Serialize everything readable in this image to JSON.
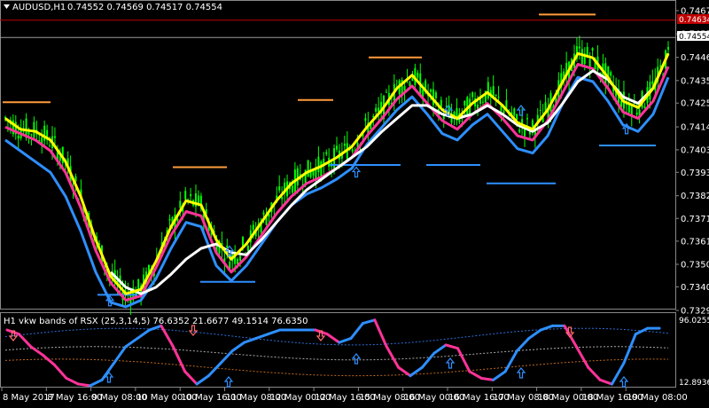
{
  "chart_header": {
    "symbol_label": "AUDUSD,H1",
    "ohlc": "0.74552 0.74569 0.74517 0.74554"
  },
  "indicator_header": {
    "label": "H1 vkw bands of RSX (25,3,14,5) 76.6352 21.6677 49.1514 76.6350"
  },
  "colors": {
    "background": "#000000",
    "candles": "#00ff00",
    "yellow_line": "#ffff00",
    "white_line": "#ffffff",
    "pink_line": "#ff3399",
    "blue_line": "#2e8fff",
    "resistance": "#ff9c3a",
    "support": "#2e8fff",
    "price_line": "#c00000",
    "bid_line": "#9a9a9a"
  },
  "chart_data": [
    {
      "type": "candlestick",
      "title": "AUDUSD,H1",
      "price_axis_ticks": [
        "0.74678",
        "0.74571",
        "0.74462",
        "0.74355",
        "0.74251",
        "0.74141",
        "0.74035",
        "0.73931",
        "0.73823",
        "0.73718",
        "0.73613",
        "0.73506",
        "0.73402",
        "0.73293"
      ],
      "ylim": [
        0.73293,
        0.74678
      ],
      "time_axis_ticks": [
        "8 May 2017",
        "8 May 16:00",
        "9 May 08:00",
        "10 May 00:00",
        "10 May 16:00",
        "11 May 08:00",
        "12 May 00:00",
        "12 May 16:00",
        "15 May 08:00",
        "16 May 00:00",
        "16 May 16:00",
        "17 May 08:00",
        "18 May 00:00",
        "18 May 16:00",
        "19 May 08:00"
      ],
      "price_labels": {
        "red": "0.74634",
        "current": "0.74554"
      },
      "series": [
        {
          "name": "yellow",
          "values": [
            0.7418,
            0.7413,
            0.7412,
            0.7408,
            0.7398,
            0.7382,
            0.7362,
            0.7345,
            0.7337,
            0.7339,
            0.7352,
            0.7368,
            0.738,
            0.7378,
            0.7362,
            0.7353,
            0.736,
            0.737,
            0.738,
            0.7388,
            0.7393,
            0.7396,
            0.74,
            0.7405,
            0.7414,
            0.7422,
            0.7432,
            0.7438,
            0.743,
            0.7422,
            0.7418,
            0.7425,
            0.743,
            0.7424,
            0.7416,
            0.7413,
            0.7422,
            0.7435,
            0.7448,
            0.7446,
            0.7437,
            0.7426,
            0.7423,
            0.7432,
            0.7448
          ]
        },
        {
          "name": "white",
          "values": [
            null,
            null,
            null,
            null,
            null,
            null,
            null,
            0.7347,
            0.734,
            0.7337,
            0.734,
            0.7346,
            0.7353,
            0.7358,
            0.736,
            0.7356,
            0.7355,
            0.7362,
            0.737,
            0.7378,
            0.7385,
            0.739,
            0.7395,
            0.74,
            0.7405,
            0.7412,
            0.7418,
            0.7424,
            0.7424,
            0.742,
            0.7418,
            0.742,
            0.7424,
            0.742,
            0.7415,
            0.7412,
            0.7416,
            0.7425,
            0.7435,
            0.744,
            0.7436,
            0.7428,
            0.7425,
            0.7432,
            0.7448
          ]
        },
        {
          "name": "pink",
          "values": [
            0.7414,
            0.7411,
            0.7408,
            0.7403,
            0.7393,
            0.7377,
            0.7357,
            0.7342,
            0.7334,
            0.7336,
            0.7349,
            0.7364,
            0.7375,
            0.7373,
            0.7356,
            0.7347,
            0.7354,
            0.7364,
            0.7374,
            0.7382,
            0.7388,
            0.7391,
            0.7395,
            0.74,
            0.741,
            0.7418,
            0.7427,
            0.7433,
            0.7425,
            0.7417,
            0.7413,
            0.742,
            0.7425,
            0.7418,
            0.741,
            0.7408,
            0.7417,
            0.743,
            0.7443,
            0.7441,
            0.7432,
            0.7421,
            0.7418,
            0.7426,
            0.7442
          ]
        },
        {
          "name": "blue",
          "values": [
            0.7408,
            0.7403,
            0.7398,
            0.7393,
            0.7382,
            0.7366,
            0.7347,
            0.7333,
            0.7331,
            0.7334,
            0.7344,
            0.7358,
            0.737,
            0.7368,
            0.735,
            0.7343,
            0.735,
            0.736,
            0.737,
            0.7378,
            0.7383,
            0.7386,
            0.739,
            0.7395,
            0.7406,
            0.7414,
            0.7422,
            0.7428,
            0.742,
            0.7411,
            0.7408,
            0.7415,
            0.742,
            0.7412,
            0.7404,
            0.7402,
            0.741,
            0.7425,
            0.7437,
            0.7435,
            0.7426,
            0.7415,
            0.7412,
            0.742,
            0.7437
          ]
        }
      ]
    },
    {
      "type": "line",
      "title": "H1 vkw bands of RSX (25,3,14,5)",
      "axis_ticks": [
        "96.0255",
        "12.8936"
      ],
      "ylim": [
        12.8936,
        96.0255
      ],
      "series": [
        {
          "name": "RSX",
          "values": [
            80,
            75,
            60,
            50,
            38,
            22,
            15,
            13,
            20,
            40,
            60,
            70,
            80,
            85,
            60,
            30,
            15,
            25,
            40,
            55,
            65,
            70,
            75,
            80,
            80,
            80,
            80,
            75,
            65,
            70,
            88,
            92,
            60,
            35,
            25,
            35,
            52,
            62,
            58,
            30,
            22,
            20,
            30,
            55,
            70,
            80,
            85,
            85,
            60,
            35,
            20,
            15,
            40,
            75,
            82,
            82
          ]
        }
      ]
    }
  ]
}
